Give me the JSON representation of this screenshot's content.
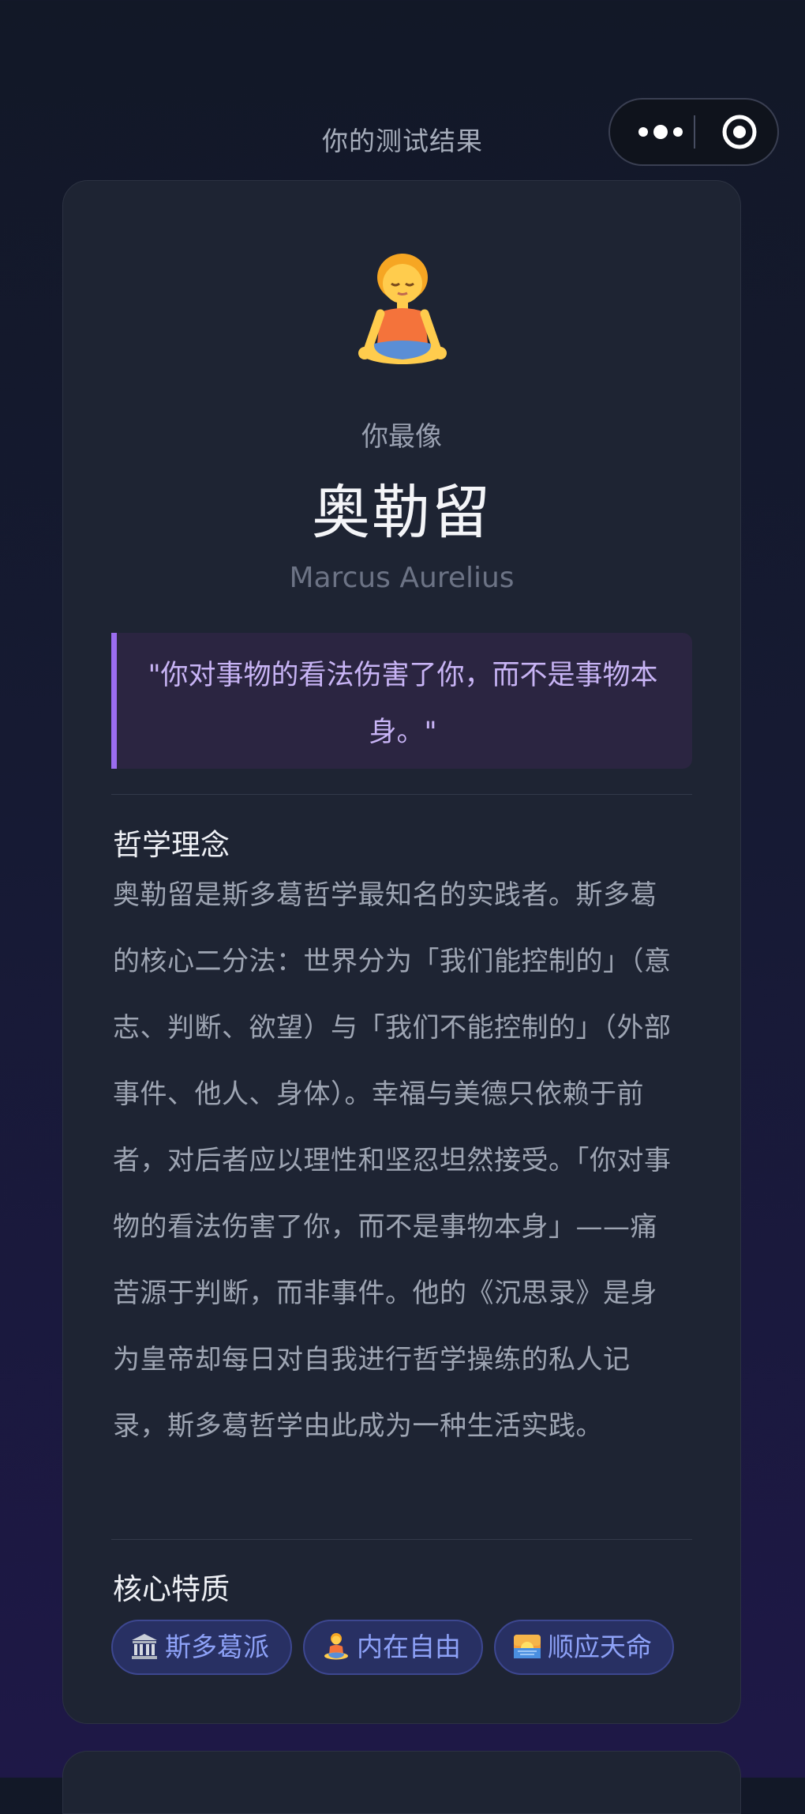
{
  "header": {
    "title": "你的测试结果"
  },
  "capsule": {
    "more_icon": "more-dots-icon",
    "close_icon": "target-close-icon"
  },
  "result": {
    "avatar_icon": "person-in-lotus-position-icon",
    "lead": "你最像",
    "name": "奥勒留",
    "name_en": "Marcus Aurelius",
    "quote": "\"你对事物的看法伤害了你，而不是事物本身。\""
  },
  "philosophy": {
    "title": "哲学理念",
    "body": "奥勒留是斯多葛哲学最知名的实践者。斯多葛的核心二分法：世界分为「我们能控制的」（意志、判断、欲望）与「我们不能控制的」（外部事件、他人、身体）。幸福与美德只依赖于前者，对后者应以理性和坚忍坦然接受。「你对事物的看法伤害了你，而不是事物本身」——痛苦源于判断，而非事件。他的《沉思录》是身为皇帝却每日对自我进行哲学操练的私人记录，斯多葛哲学由此成为一种生活实践。"
  },
  "traits": {
    "title": "核心特质",
    "tags": [
      {
        "icon": "classical-building-icon",
        "label": "斯多葛派"
      },
      {
        "icon": "person-in-lotus-position-icon",
        "label": "内在自由"
      },
      {
        "icon": "sunrise-icon",
        "label": "顺应天命"
      }
    ]
  },
  "colors": {
    "accent_purple": "#9b6df0",
    "tag_text": "#8ea2f8",
    "card_bg": "#1e2433"
  }
}
